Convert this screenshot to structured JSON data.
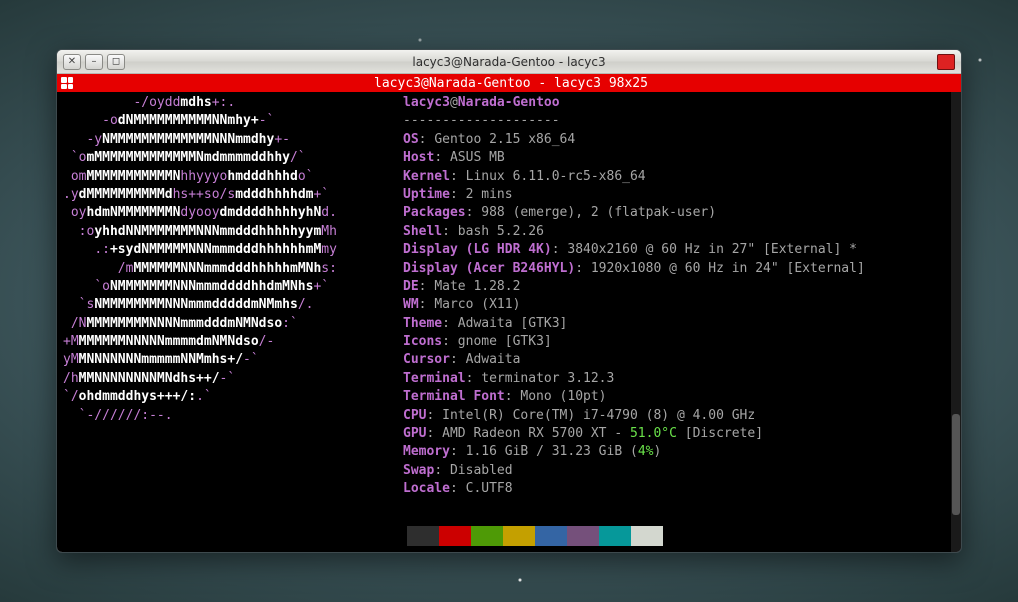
{
  "window": {
    "title": "lacyc3@Narada-Gentoo - lacyc3",
    "close_glyph": "✕",
    "minimize_glyph": "–",
    "maximize_glyph": "◻"
  },
  "terminal_tab": {
    "label": "lacyc3@Narada-Gentoo - lacyc3 98x25"
  },
  "fastfetch": {
    "userhost_user": "lacyc3",
    "userhost_at": "@",
    "userhost_host": "Narada-Gentoo",
    "divider": "--------------------",
    "rows": [
      {
        "key": "OS",
        "value": "Gentoo 2.15 x86_64"
      },
      {
        "key": "Host",
        "value": "ASUS MB"
      },
      {
        "key": "Kernel",
        "value": "Linux 6.11.0-rc5-x86_64"
      },
      {
        "key": "Uptime",
        "value": "2 mins"
      },
      {
        "key": "Packages",
        "value": "988 (emerge), 2 (flatpak-user)"
      },
      {
        "key": "Shell",
        "value": "bash 5.2.26"
      },
      {
        "key": "Display (LG HDR 4K)",
        "value": "3840x2160 @ 60 Hz in 27\" [External] *"
      },
      {
        "key": "Display (Acer B246HYL)",
        "value": "1920x1080 @ 60 Hz in 24\" [External]"
      },
      {
        "key": "DE",
        "value": "Mate 1.28.2"
      },
      {
        "key": "WM",
        "value": "Marco (X11)"
      },
      {
        "key": "Theme",
        "value": "Adwaita [GTK3]"
      },
      {
        "key": "Icons",
        "value": "gnome [GTK3]"
      },
      {
        "key": "Cursor",
        "value": "Adwaita"
      },
      {
        "key": "Terminal",
        "value": "terminator 3.12.3"
      },
      {
        "key": "Terminal Font",
        "value": "Mono (10pt)"
      },
      {
        "key": "CPU",
        "value": "Intel(R) Core(TM) i7-4790 (8) @ 4.00 GHz"
      },
      {
        "key": "GPU",
        "value_before": "AMD Radeon RX 5700 XT - ",
        "value_highlight": "51.0°C",
        "value_after": " [Discrete]"
      },
      {
        "key": "Memory",
        "value_before": "1.16 GiB / 31.23 GiB (",
        "value_highlight": "4%",
        "value_after": ")"
      },
      {
        "key": "Swap",
        "value": "Disabled"
      },
      {
        "key": "Locale",
        "value": "C.UTF8"
      }
    ]
  },
  "logo_lines": [
    {
      "pad": 9,
      "segs": [
        [
          "mag",
          "-/oydd"
        ],
        [
          "wht",
          "mdhs"
        ],
        [
          "mag",
          "+:."
        ]
      ]
    },
    {
      "pad": 5,
      "segs": [
        [
          "mag",
          "-o"
        ],
        [
          "wht",
          "dNMMMMMMMMMMNNmhy+"
        ],
        [
          "mag",
          "-`"
        ]
      ]
    },
    {
      "pad": 3,
      "segs": [
        [
          "mag",
          "-y"
        ],
        [
          "wht",
          "NMMMMMMMMMMMMMNNNmmdhy"
        ],
        [
          "mag",
          "+-"
        ]
      ]
    },
    {
      "pad": 1,
      "segs": [
        [
          "mag",
          "`o"
        ],
        [
          "wht",
          "mMMMMMMMMMMMMMNmdmmmmddhhy"
        ],
        [
          "mag",
          "/`"
        ]
      ]
    },
    {
      "pad": 1,
      "segs": [
        [
          "mag",
          "om"
        ],
        [
          "wht",
          "MMMMMMMMMMMN"
        ],
        [
          "mag",
          "hhyyyo"
        ],
        [
          "wht",
          "hmdddhhhd"
        ],
        [
          "mag",
          "o`"
        ]
      ]
    },
    {
      "pad": 0,
      "segs": [
        [
          "mag",
          ".y"
        ],
        [
          "wht",
          "dMMMMMMMMMMd"
        ],
        [
          "mag",
          "hs++so/s"
        ],
        [
          "wht",
          "mdddhhhhdm"
        ],
        [
          "mag",
          "+`"
        ]
      ]
    },
    {
      "pad": 1,
      "segs": [
        [
          "mag",
          "oy"
        ],
        [
          "wht",
          "hdmNMMMMMMMN"
        ],
        [
          "mag",
          "dyooy"
        ],
        [
          "wht",
          "dmddddhhhhyhN"
        ],
        [
          "mag",
          "d."
        ]
      ]
    },
    {
      "pad": 2,
      "segs": [
        [
          "mag",
          ":o"
        ],
        [
          "wht",
          "yhhdNNMMMMMMMNNNmmdddhhhhhyym"
        ],
        [
          "mag",
          "Mh"
        ]
      ]
    },
    {
      "pad": 4,
      "segs": [
        [
          "mag",
          ".:"
        ],
        [
          "wht",
          "+sydNMMMMMNNNmmmdddhhhhhhmM"
        ],
        [
          "mag",
          "my"
        ]
      ]
    },
    {
      "pad": 7,
      "segs": [
        [
          "mag",
          "/m"
        ],
        [
          "wht",
          "MMMMMMNNNmmmdddhhhhhmMNh"
        ],
        [
          "mag",
          "s:"
        ]
      ]
    },
    {
      "pad": 4,
      "segs": [
        [
          "mag",
          "`o"
        ],
        [
          "wht",
          "NMMMMMMMNNNmmmddddhhdmMNhs"
        ],
        [
          "mag",
          "+`"
        ]
      ]
    },
    {
      "pad": 2,
      "segs": [
        [
          "mag",
          "`s"
        ],
        [
          "wht",
          "NMMMMMMMMNNNmmmdddddmNMmhs"
        ],
        [
          "mag",
          "/."
        ]
      ]
    },
    {
      "pad": 1,
      "segs": [
        [
          "mag",
          "/N"
        ],
        [
          "wht",
          "MMMMMMMMNNNNmmmdddmNMNdso"
        ],
        [
          "mag",
          ":`"
        ]
      ]
    },
    {
      "pad": 0,
      "segs": [
        [
          "mag",
          "+M"
        ],
        [
          "wht",
          "MMMMMMNNNNNmmmmdmNMNdso"
        ],
        [
          "mag",
          "/-"
        ]
      ]
    },
    {
      "pad": 0,
      "segs": [
        [
          "mag",
          "yM"
        ],
        [
          "wht",
          "MNNNNNNNmmmmmNNMmhs+/"
        ],
        [
          "mag",
          "-`"
        ]
      ]
    },
    {
      "pad": 0,
      "segs": [
        [
          "mag",
          "/h"
        ],
        [
          "wht",
          "MMNNNNNNNNMNdhs++/"
        ],
        [
          "mag",
          "-`"
        ]
      ]
    },
    {
      "pad": 0,
      "segs": [
        [
          "mag",
          "`/"
        ],
        [
          "wht",
          "ohdmmddhys+++/:"
        ],
        [
          "mag",
          ".`"
        ]
      ]
    },
    {
      "pad": 2,
      "segs": [
        [
          "mag",
          "`-//////:--."
        ]
      ]
    }
  ],
  "palette": [
    "#2e2e2e",
    "#cc0000",
    "#4e9a06",
    "#c4a000",
    "#3465a4",
    "#75507b",
    "#06989a",
    "#d3d7cf"
  ]
}
